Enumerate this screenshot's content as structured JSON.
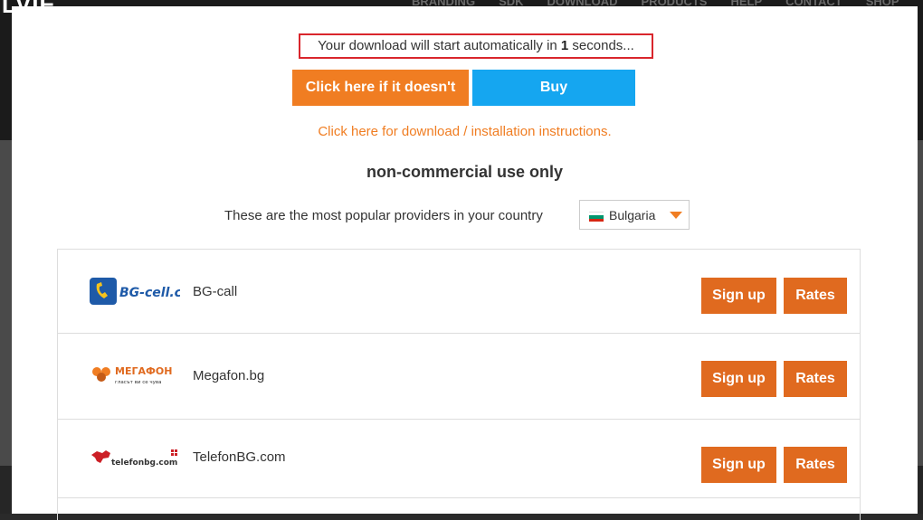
{
  "background": {
    "logo": "LVIE",
    "nav": [
      "BRANDING",
      "SDK",
      "DOWNLOAD",
      "PRODUCTS",
      "HELP",
      "CONTACT",
      "SHOP"
    ]
  },
  "modal": {
    "countdown_prefix": "Your download will start automatically in ",
    "countdown_seconds": "1",
    "countdown_suffix": " seconds...",
    "click_here_label": "Click here if it doesn't",
    "buy_label": "Buy",
    "instructions_link": "Click here for download / installation instructions.",
    "noncommercial": "non-commercial use only",
    "providers_text": "These are the most popular providers in your country",
    "country": "Bulgaria"
  },
  "providers": [
    {
      "name": "BG-call",
      "logo_text": "BG-cell.com",
      "signup": "Sign up",
      "rates": "Rates"
    },
    {
      "name": "Megafon.bg",
      "logo_text": "МЕГАФОН",
      "logo_sub": "гласът ви се чува",
      "signup": "Sign up",
      "rates": "Rates"
    },
    {
      "name": "TelefonBG.com",
      "logo_text": "telefonbg.com",
      "signup": "Sign up",
      "rates": "Rates"
    }
  ],
  "colors": {
    "orange": "#f07d22",
    "blue": "#15a6f0",
    "highlight_border": "#d9262c"
  }
}
